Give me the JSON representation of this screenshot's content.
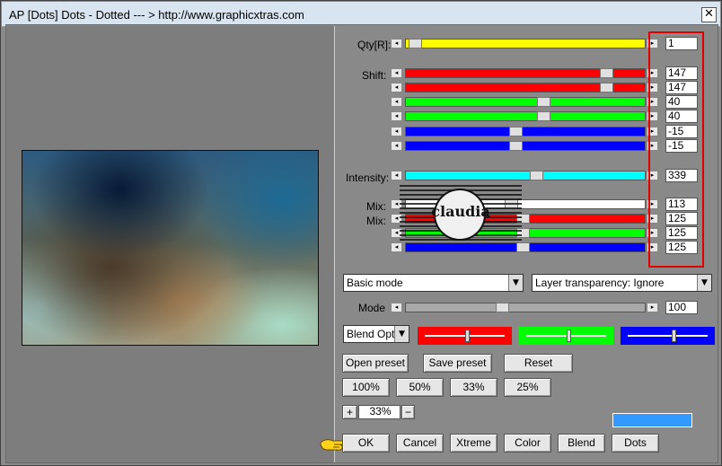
{
  "window": {
    "title": "AP [Dots]  Dots - Dotted    --- > http://www.graphicxtras.com",
    "close_glyph": "✕"
  },
  "icons": {
    "arrow_left": "◂",
    "arrow_right": "▸",
    "dropdown": "▼"
  },
  "labels": {
    "qty": "Qty[R]:",
    "shift": "Shift:",
    "intensity": "Intensity:",
    "mix1": "Mix:",
    "mix2": "Mix:",
    "mode": "Mode"
  },
  "values": {
    "qty": "1",
    "shift": [
      "147",
      "147",
      "40",
      "40",
      "-15",
      "-15"
    ],
    "intensity": "339",
    "mix": [
      "113",
      "125",
      "125",
      "125"
    ],
    "mode": "100"
  },
  "slider_colors": {
    "qty": "#ffff00",
    "shift": [
      "#ff0000",
      "#ff0000",
      "#00ff00",
      "#00ff00",
      "#0000ff",
      "#0000ff"
    ],
    "intensity": "#00ffff",
    "mix": [
      "#ffffff",
      "#ff0000",
      "#00ff00",
      "#0000ff"
    ],
    "mode": "#a8a8a8"
  },
  "slider_levels": {
    "qty": 0.01,
    "shift": [
      0.86,
      0.86,
      0.58,
      0.58,
      0.46,
      0.46
    ],
    "intensity": 0.55,
    "mix": [
      0.44,
      0.49,
      0.49,
      0.49
    ],
    "mode": 0.4
  },
  "dropdowns": {
    "basic_mode": "Basic mode",
    "layer_transparency": "Layer transparency: Ignore",
    "blend_options": "Blend Optio"
  },
  "color_sliders": {
    "red": "#ff0000",
    "green": "#00ff00",
    "blue": "#0000ff",
    "levels": [
      0.5,
      0.5,
      0.55
    ]
  },
  "buttons": {
    "open_preset": "Open preset",
    "save_preset": "Save preset",
    "reset": "Reset",
    "zoom_100": "100%",
    "zoom_50": "50%",
    "zoom_33": "33%",
    "zoom_25": "25%",
    "zoom_plus": "+",
    "zoom_minus": "−",
    "ok": "OK",
    "cancel": "Cancel",
    "xtreme": "Xtreme",
    "color": "Color",
    "blend": "Blend",
    "dots": "Dots"
  },
  "zoom_value": "33%",
  "color_swatch": "#3399ff",
  "watermark_text": "claudia"
}
